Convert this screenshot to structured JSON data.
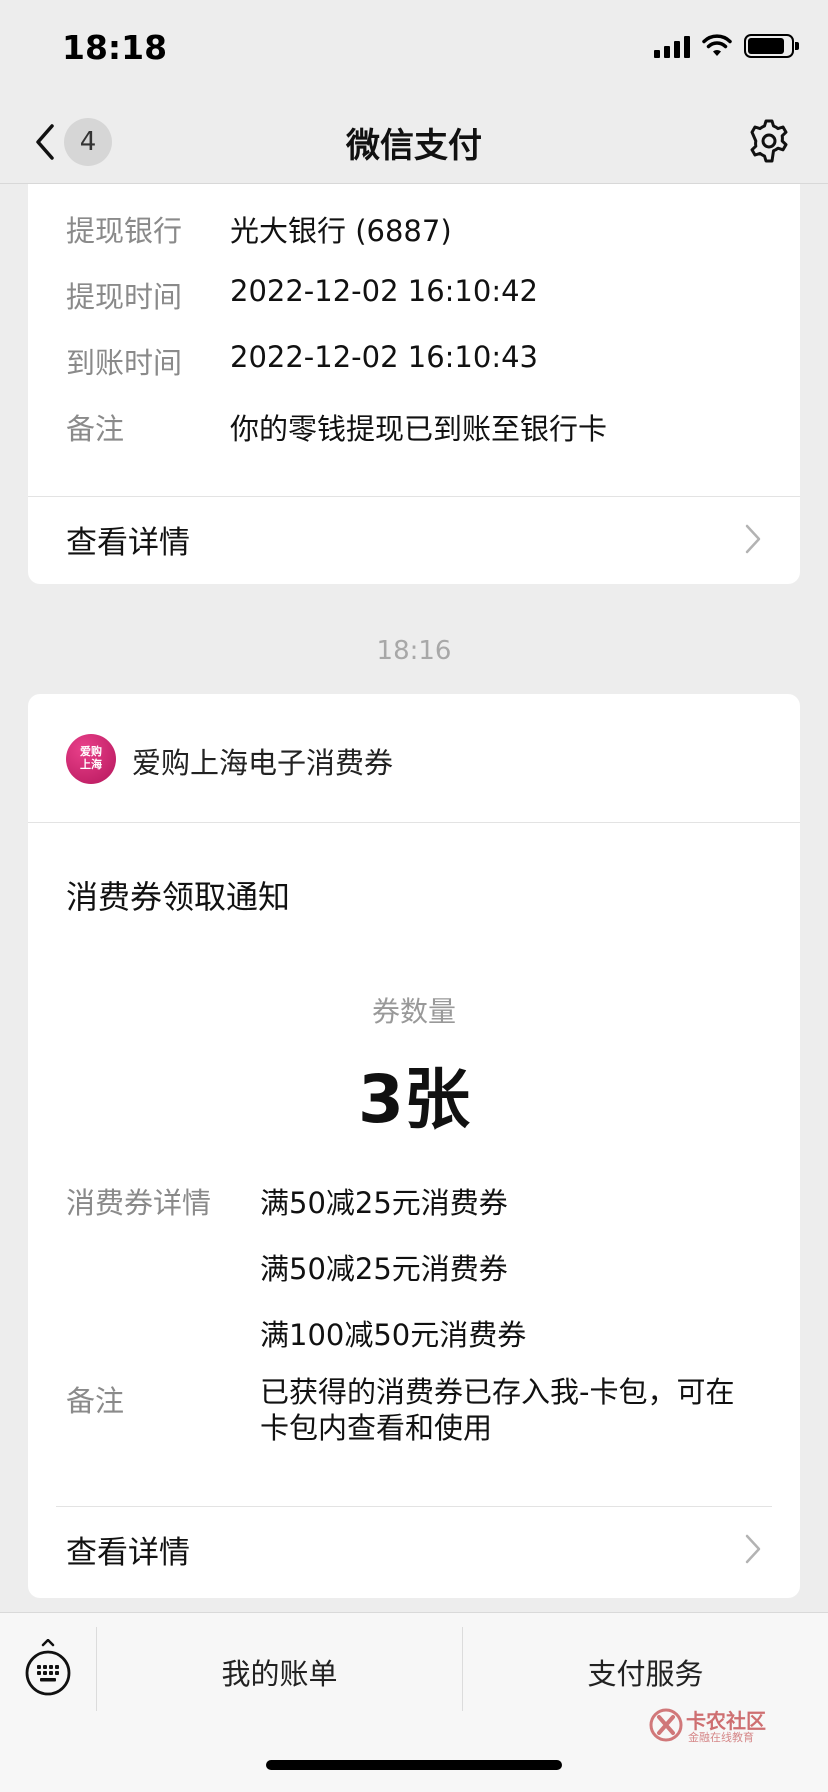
{
  "status_bar": {
    "time": "18:18"
  },
  "nav": {
    "badge_count": "4",
    "title": "微信支付"
  },
  "withdraw_card": {
    "rows": [
      {
        "label": "提现银行",
        "value": "光大银行 (6887)"
      },
      {
        "label": "提现时间",
        "value": "2022-12-02 16:10:42"
      },
      {
        "label": "到账时间",
        "value": "2022-12-02 16:10:43"
      },
      {
        "label": "备注",
        "value": "你的零钱提现已到账至银行卡"
      }
    ],
    "detail_link": "查看详情"
  },
  "message_time": "18:16",
  "coupon_card": {
    "brand": {
      "logo_text": "爱购上海",
      "name": "爱购上海电子消费券"
    },
    "title": "消费券领取通知",
    "quantity_label": "券数量",
    "quantity_value": "3张",
    "details_label": "消费券详情",
    "details": [
      "满50减25元消费券",
      "满50减25元消费券",
      "满100减50元消费券"
    ],
    "remark_label": "备注",
    "remark_value": "已获得的消费券已存入我-卡包，可在卡包内查看和使用",
    "detail_link": "查看详情"
  },
  "bottom_bar": {
    "tabs": [
      "我的账单",
      "支付服务"
    ]
  },
  "watermark": {
    "title": "卡农社区",
    "subtitle": "金融在线教育"
  }
}
